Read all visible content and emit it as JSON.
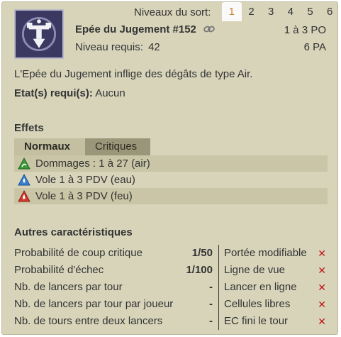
{
  "header": {
    "levels_label": "Niveaux du sort:",
    "levels": [
      "1",
      "2",
      "3",
      "4",
      "5",
      "6"
    ],
    "active_level_index": 0,
    "spell_name": "Epée du Jugement #152",
    "required_label": "Niveau requis:",
    "required_value": "42",
    "range": "1 à 3 PO",
    "ap": "6 PA"
  },
  "description": "L'Epée du Jugement inflige des dégâts de type Air.",
  "states": {
    "label": "Etat(s) requi(s):",
    "value": "Aucun"
  },
  "effects": {
    "title": "Effets",
    "tabs": [
      {
        "label": "Normaux",
        "active": true
      },
      {
        "label": "Critiques",
        "active": false
      }
    ],
    "rows": [
      {
        "icon": "air-element-icon",
        "color": "#3a9a3a",
        "text": "Dommages : 1 à 27 (air)"
      },
      {
        "icon": "water-element-icon",
        "color": "#3a7ed0",
        "text": "Vole 1 à 3 PDV (eau)"
      },
      {
        "icon": "fire-element-icon",
        "color": "#d03a2a",
        "text": "Vole 1 à 3 PDV (feu)"
      }
    ]
  },
  "other": {
    "title": "Autres caractéristiques",
    "left": [
      {
        "label": "Probabilité de coup critique",
        "value": "1/50"
      },
      {
        "label": "Probabilité d'échec",
        "value": "1/100"
      },
      {
        "label": "Nb. de lancers par tour",
        "value": "-"
      },
      {
        "label": "Nb. de lancers par tour par joueur",
        "value": "-"
      },
      {
        "label": "Nb. de tours entre deux lancers",
        "value": "-"
      }
    ],
    "right": [
      {
        "label": "Portée modifiable",
        "mark": "✕"
      },
      {
        "label": "Ligne de vue",
        "mark": "✕"
      },
      {
        "label": "Lancer en ligne",
        "mark": "✕"
      },
      {
        "label": "Cellules libres",
        "mark": "✕"
      },
      {
        "label": "EC fini le tour",
        "mark": "✕"
      }
    ]
  }
}
